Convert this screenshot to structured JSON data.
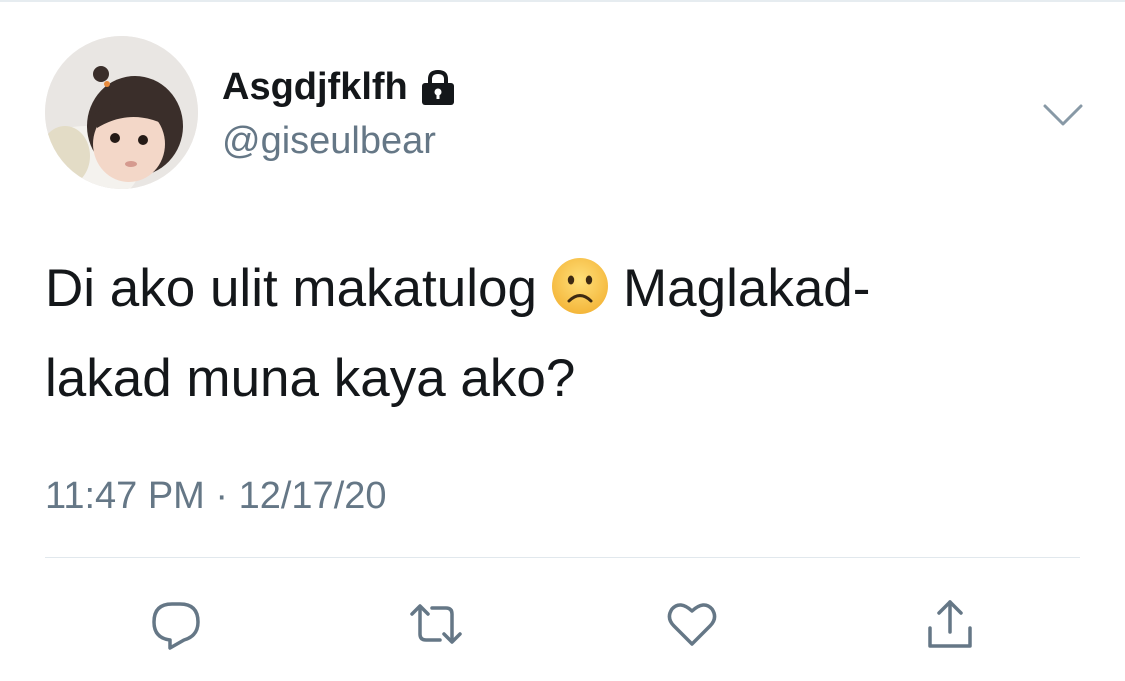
{
  "user": {
    "display_name": "Asgdjfklfh",
    "handle": "@giseulbear"
  },
  "tweet": {
    "line1_before_emoji": "Di ako ulit makatulog",
    "line1_after_emoji": "Maglakad-",
    "line2": "lakad muna kaya ako?",
    "emoji": "frowning-face-emoji"
  },
  "meta": {
    "timestamp": "11:47 PM · 12/17/20"
  },
  "icons": {
    "lock": "lock-icon",
    "more": "chevron-down-icon",
    "reply": "reply-icon",
    "retweet": "retweet-icon",
    "like": "heart-icon",
    "share": "share-icon"
  },
  "colors": {
    "text_primary": "#14171a",
    "text_secondary": "#657786",
    "icon_gray": "#657786",
    "divider": "#e1e8ed"
  }
}
